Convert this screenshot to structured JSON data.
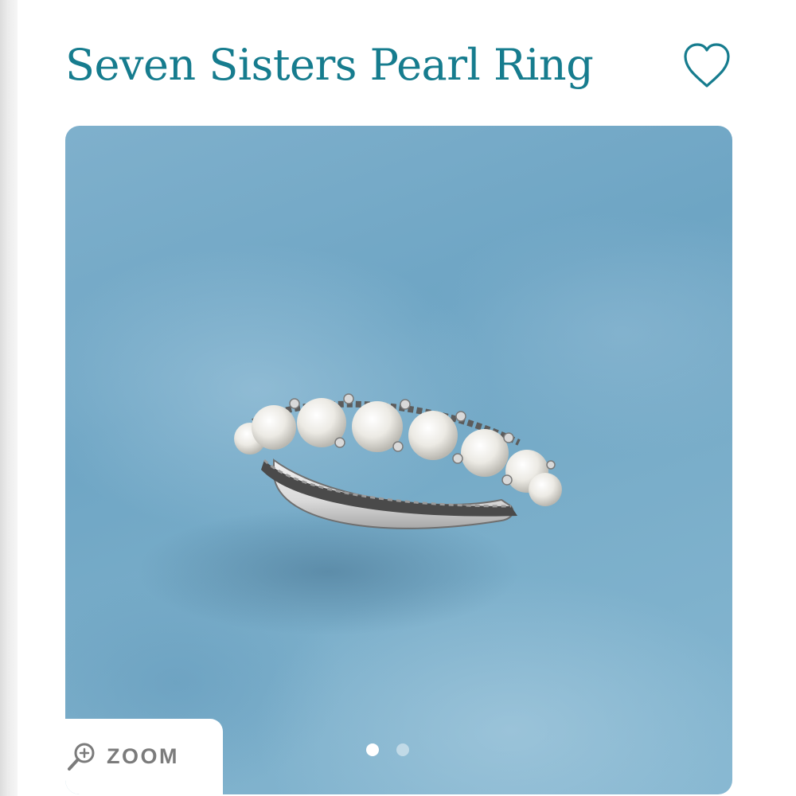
{
  "product": {
    "title": "Seven Sisters Pearl Ring",
    "image_alt": "Sterling silver band set with seven pearls on a blue textured background"
  },
  "actions": {
    "favorite_icon": "heart-outline-icon",
    "zoom_label": "ZOOM",
    "zoom_icon": "magnifier-plus-icon"
  },
  "carousel": {
    "total_slides": 2,
    "active_slide": 1
  },
  "colors": {
    "brand": "#167c8e",
    "zoom_text": "#7b7b7b",
    "background_blue": "#7fb0cc"
  }
}
